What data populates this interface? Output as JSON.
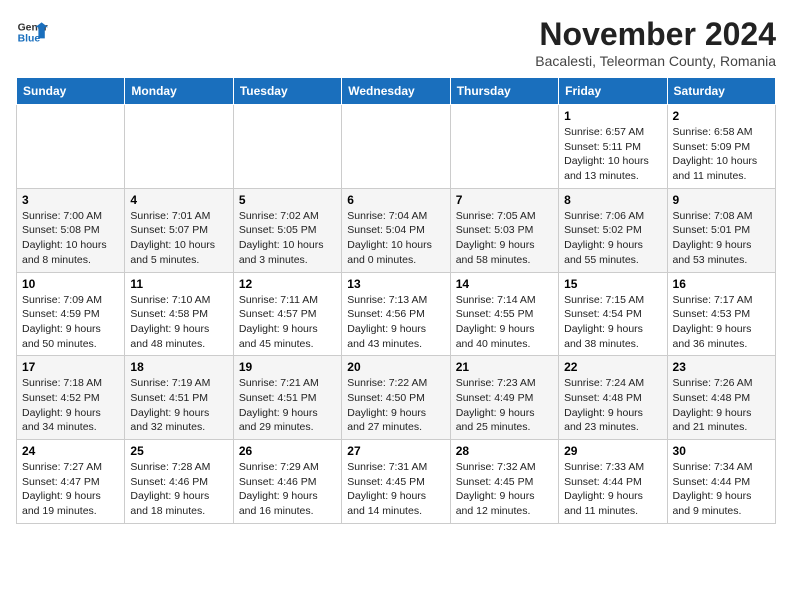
{
  "logo": {
    "general": "General",
    "blue": "Blue"
  },
  "title": "November 2024",
  "subtitle": "Bacalesti, Teleorman County, Romania",
  "weekdays": [
    "Sunday",
    "Monday",
    "Tuesday",
    "Wednesday",
    "Thursday",
    "Friday",
    "Saturday"
  ],
  "weeks": [
    [
      {
        "day": "",
        "info": ""
      },
      {
        "day": "",
        "info": ""
      },
      {
        "day": "",
        "info": ""
      },
      {
        "day": "",
        "info": ""
      },
      {
        "day": "",
        "info": ""
      },
      {
        "day": "1",
        "info": "Sunrise: 6:57 AM\nSunset: 5:11 PM\nDaylight: 10 hours and 13 minutes."
      },
      {
        "day": "2",
        "info": "Sunrise: 6:58 AM\nSunset: 5:09 PM\nDaylight: 10 hours and 11 minutes."
      }
    ],
    [
      {
        "day": "3",
        "info": "Sunrise: 7:00 AM\nSunset: 5:08 PM\nDaylight: 10 hours and 8 minutes."
      },
      {
        "day": "4",
        "info": "Sunrise: 7:01 AM\nSunset: 5:07 PM\nDaylight: 10 hours and 5 minutes."
      },
      {
        "day": "5",
        "info": "Sunrise: 7:02 AM\nSunset: 5:05 PM\nDaylight: 10 hours and 3 minutes."
      },
      {
        "day": "6",
        "info": "Sunrise: 7:04 AM\nSunset: 5:04 PM\nDaylight: 10 hours and 0 minutes."
      },
      {
        "day": "7",
        "info": "Sunrise: 7:05 AM\nSunset: 5:03 PM\nDaylight: 9 hours and 58 minutes."
      },
      {
        "day": "8",
        "info": "Sunrise: 7:06 AM\nSunset: 5:02 PM\nDaylight: 9 hours and 55 minutes."
      },
      {
        "day": "9",
        "info": "Sunrise: 7:08 AM\nSunset: 5:01 PM\nDaylight: 9 hours and 53 minutes."
      }
    ],
    [
      {
        "day": "10",
        "info": "Sunrise: 7:09 AM\nSunset: 4:59 PM\nDaylight: 9 hours and 50 minutes."
      },
      {
        "day": "11",
        "info": "Sunrise: 7:10 AM\nSunset: 4:58 PM\nDaylight: 9 hours and 48 minutes."
      },
      {
        "day": "12",
        "info": "Sunrise: 7:11 AM\nSunset: 4:57 PM\nDaylight: 9 hours and 45 minutes."
      },
      {
        "day": "13",
        "info": "Sunrise: 7:13 AM\nSunset: 4:56 PM\nDaylight: 9 hours and 43 minutes."
      },
      {
        "day": "14",
        "info": "Sunrise: 7:14 AM\nSunset: 4:55 PM\nDaylight: 9 hours and 40 minutes."
      },
      {
        "day": "15",
        "info": "Sunrise: 7:15 AM\nSunset: 4:54 PM\nDaylight: 9 hours and 38 minutes."
      },
      {
        "day": "16",
        "info": "Sunrise: 7:17 AM\nSunset: 4:53 PM\nDaylight: 9 hours and 36 minutes."
      }
    ],
    [
      {
        "day": "17",
        "info": "Sunrise: 7:18 AM\nSunset: 4:52 PM\nDaylight: 9 hours and 34 minutes."
      },
      {
        "day": "18",
        "info": "Sunrise: 7:19 AM\nSunset: 4:51 PM\nDaylight: 9 hours and 32 minutes."
      },
      {
        "day": "19",
        "info": "Sunrise: 7:21 AM\nSunset: 4:51 PM\nDaylight: 9 hours and 29 minutes."
      },
      {
        "day": "20",
        "info": "Sunrise: 7:22 AM\nSunset: 4:50 PM\nDaylight: 9 hours and 27 minutes."
      },
      {
        "day": "21",
        "info": "Sunrise: 7:23 AM\nSunset: 4:49 PM\nDaylight: 9 hours and 25 minutes."
      },
      {
        "day": "22",
        "info": "Sunrise: 7:24 AM\nSunset: 4:48 PM\nDaylight: 9 hours and 23 minutes."
      },
      {
        "day": "23",
        "info": "Sunrise: 7:26 AM\nSunset: 4:48 PM\nDaylight: 9 hours and 21 minutes."
      }
    ],
    [
      {
        "day": "24",
        "info": "Sunrise: 7:27 AM\nSunset: 4:47 PM\nDaylight: 9 hours and 19 minutes."
      },
      {
        "day": "25",
        "info": "Sunrise: 7:28 AM\nSunset: 4:46 PM\nDaylight: 9 hours and 18 minutes."
      },
      {
        "day": "26",
        "info": "Sunrise: 7:29 AM\nSunset: 4:46 PM\nDaylight: 9 hours and 16 minutes."
      },
      {
        "day": "27",
        "info": "Sunrise: 7:31 AM\nSunset: 4:45 PM\nDaylight: 9 hours and 14 minutes."
      },
      {
        "day": "28",
        "info": "Sunrise: 7:32 AM\nSunset: 4:45 PM\nDaylight: 9 hours and 12 minutes."
      },
      {
        "day": "29",
        "info": "Sunrise: 7:33 AM\nSunset: 4:44 PM\nDaylight: 9 hours and 11 minutes."
      },
      {
        "day": "30",
        "info": "Sunrise: 7:34 AM\nSunset: 4:44 PM\nDaylight: 9 hours and 9 minutes."
      }
    ]
  ]
}
